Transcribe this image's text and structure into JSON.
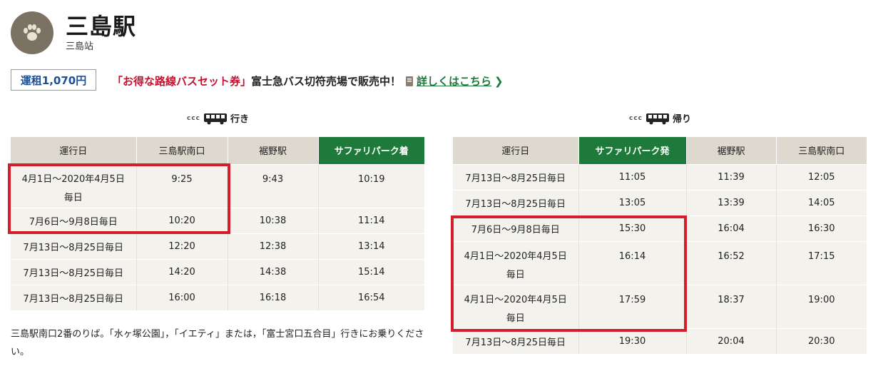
{
  "station": {
    "name": "三島駅",
    "subtitle": "三島站",
    "logo_icon": "paw-icon"
  },
  "fare": "運租1,070円",
  "promo": {
    "highlight": "「お得な路線バスセット券」",
    "text": "富士急バス切符売場で販売中！",
    "link": "詳しくはこちら",
    "chevron": "❯"
  },
  "outbound": {
    "label": "行き",
    "dots": "ccc",
    "headers": [
      "運行日",
      "三島駅南口",
      "裾野駅",
      "サファリパーク着"
    ],
    "highlight_header_index": 3,
    "rows": [
      {
        "date": "4月1日〜2020年4月5日",
        "date2": "毎日",
        "t1": "9:25",
        "t2": "9:43",
        "t3": "10:19"
      },
      {
        "date": "7月6日〜9月8日毎日",
        "t1": "10:20",
        "t2": "10:38",
        "t3": "11:14"
      },
      {
        "date": "7月13日〜8月25日毎日",
        "t1": "12:20",
        "t2": "12:38",
        "t3": "13:14"
      },
      {
        "date": "7月13日〜8月25日毎日",
        "t1": "14:20",
        "t2": "14:38",
        "t3": "15:14"
      },
      {
        "date": "7月13日〜8月25日毎日",
        "t1": "16:00",
        "t2": "16:18",
        "t3": "16:54"
      }
    ]
  },
  "return": {
    "label": "帰り",
    "dots": "ccc",
    "headers": [
      "運行日",
      "サファリパーク発",
      "裾野駅",
      "三島駅南口"
    ],
    "highlight_header_index": 1,
    "rows": [
      {
        "date": "7月13日〜8月25日毎日",
        "t1": "11:05",
        "t2": "11:39",
        "t3": "12:05"
      },
      {
        "date": "7月13日〜8月25日毎日",
        "t1": "13:05",
        "t2": "13:39",
        "t3": "14:05"
      },
      {
        "date": "7月6日〜9月8日毎日",
        "t1": "15:30",
        "t2": "16:04",
        "t3": "16:30"
      },
      {
        "date": "4月1日〜2020年4月5日",
        "date2": "毎日",
        "t1": "16:14",
        "t2": "16:52",
        "t3": "17:15"
      },
      {
        "date": "4月1日〜2020年4月5日",
        "date2": "毎日",
        "t1": "17:59",
        "t2": "18:37",
        "t3": "19:00"
      },
      {
        "date": "7月13日〜8月25日毎日",
        "t1": "19:30",
        "t2": "20:04",
        "t3": "20:30"
      }
    ]
  },
  "note": "三島駅南口2番のりば。「水ヶ塚公園」，「イエティ」または，「富士宮口五合目」行きにお乗りください。",
  "colors": {
    "accent_green": "#1e7a3a",
    "promo_red": "#c8102e",
    "fare_blue": "#1e4f93",
    "highlight_box": "#d21f2b",
    "header_bg": "#ded9cf",
    "cell_bg": "#f4f2ed"
  }
}
